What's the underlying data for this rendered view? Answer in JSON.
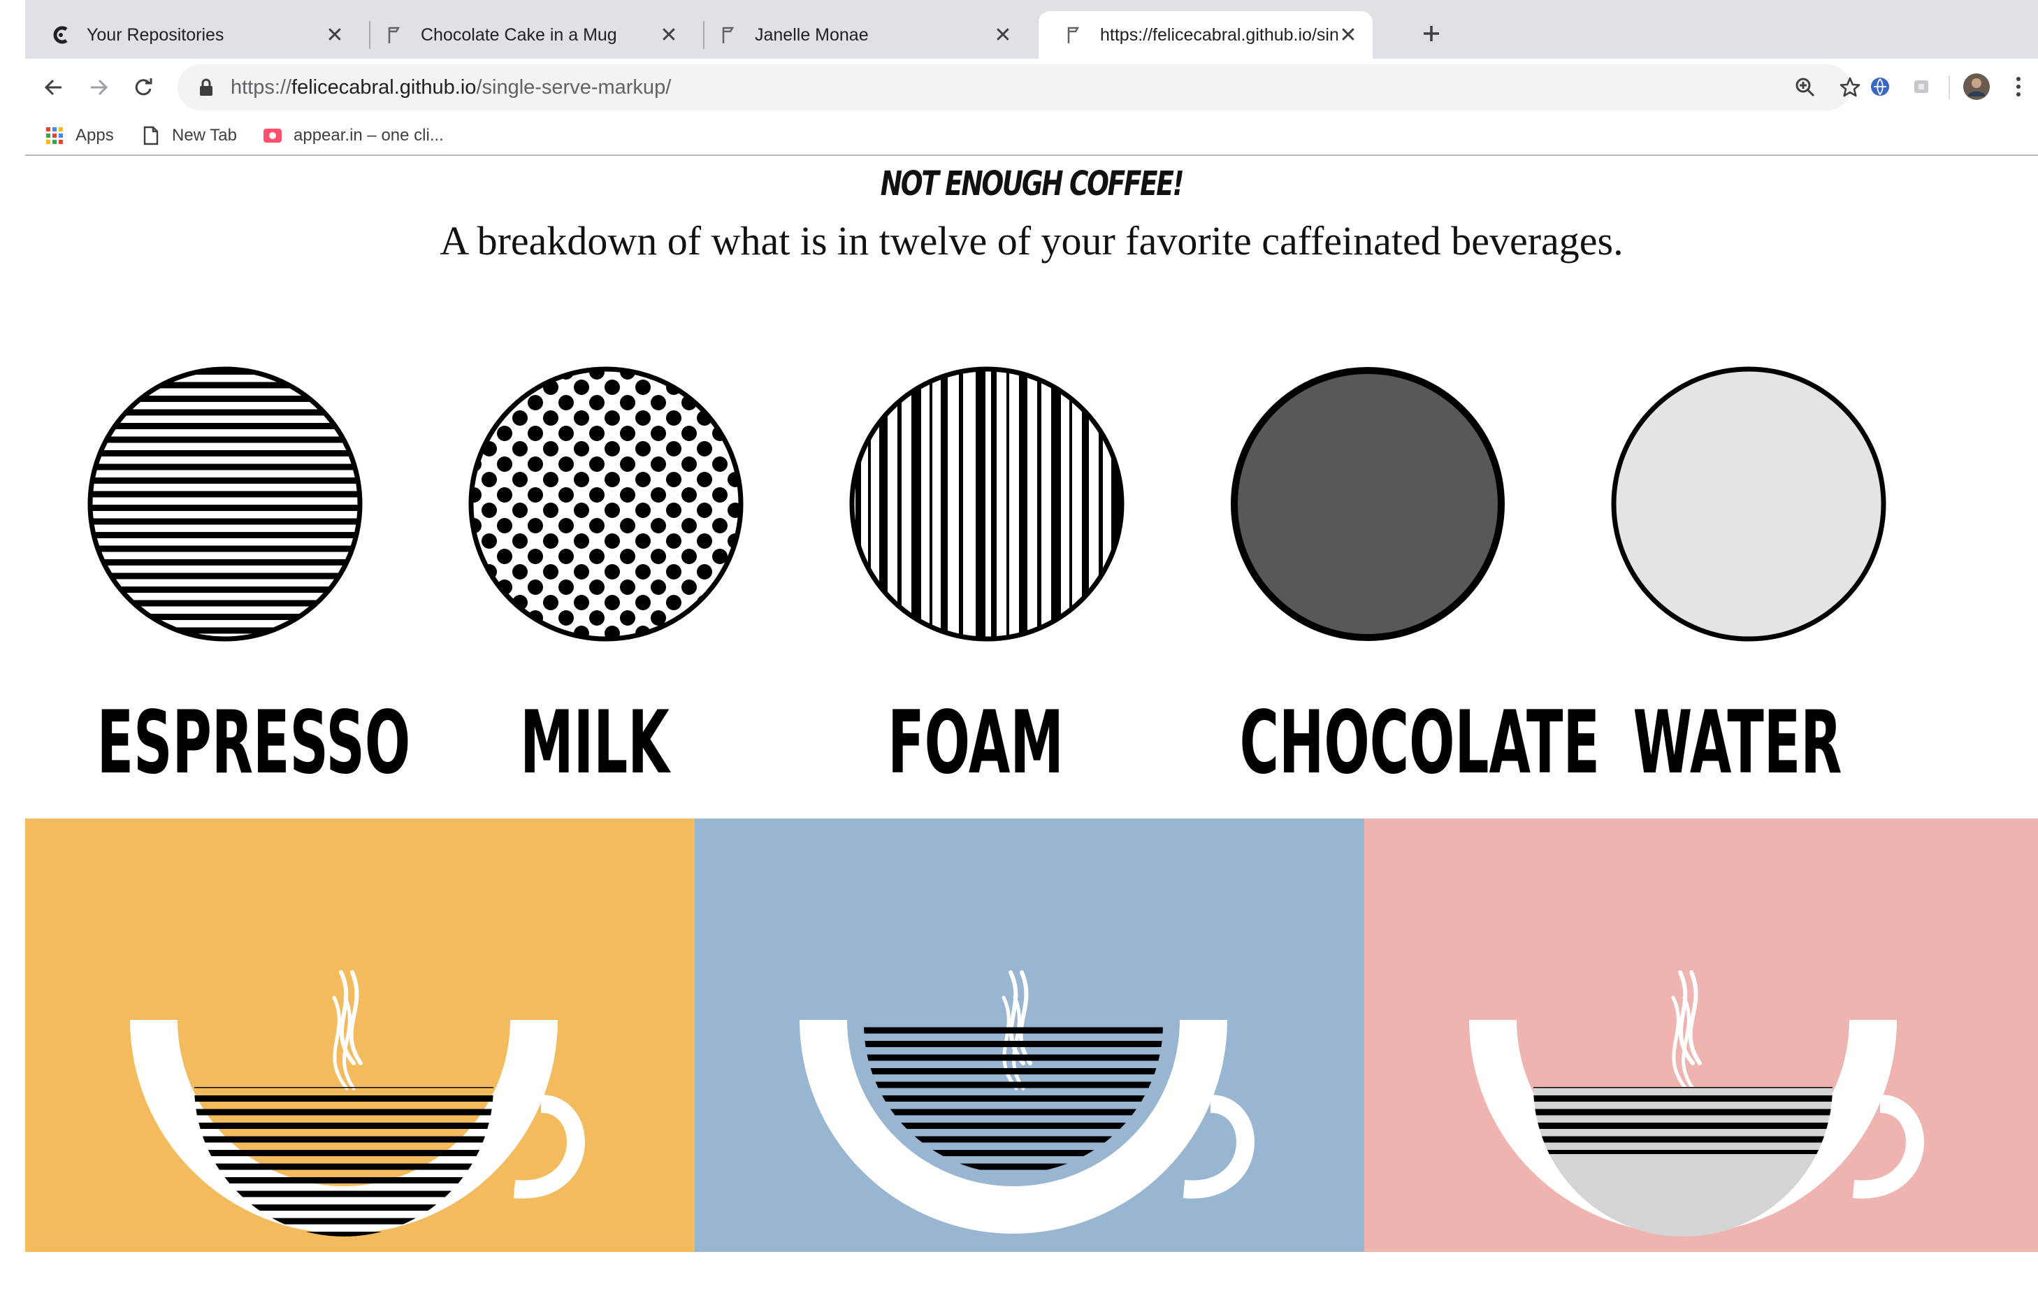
{
  "browser": {
    "tabs": [
      {
        "title": "Your Repositories",
        "icon": "glitch-logo-icon",
        "active": false
      },
      {
        "title": "Chocolate Cake in a Mug",
        "icon": "page-flag-icon",
        "active": false
      },
      {
        "title": "Janelle Monae",
        "icon": "page-flag-icon",
        "active": false
      },
      {
        "title": "https://felicecabral.github.io/single-serve-markup/",
        "icon": "page-flag-icon",
        "active": true
      }
    ],
    "url": {
      "scheme": "https://",
      "host": "felicecabral.github.io",
      "path": "/single-serve-markup/"
    },
    "bookmarks": [
      {
        "label": "Apps",
        "icon": "apps-grid-icon"
      },
      {
        "label": "New Tab",
        "icon": "document-icon"
      },
      {
        "label": "appear.in – one cli...",
        "icon": "appear-in-icon"
      }
    ]
  },
  "page": {
    "title": "NOT ENOUGH COFFEE!",
    "subtitle": "A breakdown of what is in twelve of your favorite caffeinated beverages.",
    "legend": [
      {
        "label": "ESPRESSO",
        "pattern": "horizontal-stripes"
      },
      {
        "label": "MILK",
        "pattern": "polka-dots"
      },
      {
        "label": "FOAM",
        "pattern": "vertical-stripes"
      },
      {
        "label": "CHOCOLATE",
        "pattern": "solid",
        "fill": "#58585a"
      },
      {
        "label": "WATER",
        "pattern": "solid",
        "fill": "#e3e4e6"
      }
    ],
    "drinks": [
      {
        "background": "#f3bb5d",
        "layers": [
          "espresso"
        ]
      },
      {
        "background": "#98b5d2",
        "layers": [
          "espresso"
        ]
      },
      {
        "background": "#efb4b0",
        "layers": [
          "espresso",
          "water"
        ]
      }
    ]
  }
}
